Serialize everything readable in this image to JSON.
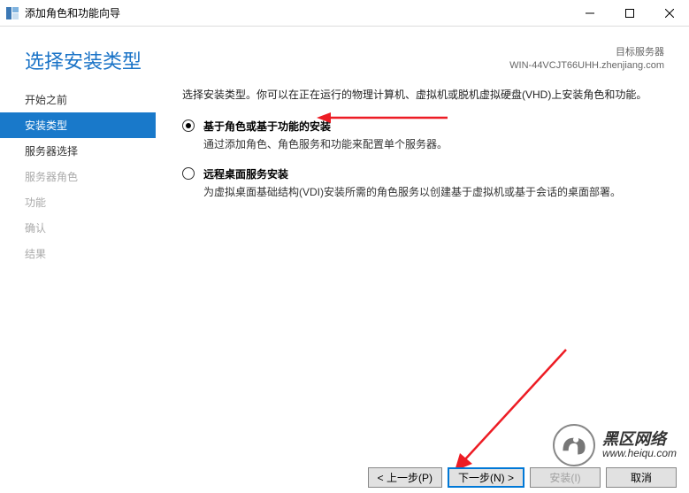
{
  "window": {
    "title": "添加角色和功能向导"
  },
  "header": {
    "page_title": "选择安装类型",
    "target_label": "目标服务器",
    "target_value": "WIN-44VCJT66UHH.zhenjiang.com"
  },
  "sidebar": {
    "items": [
      {
        "label": "开始之前"
      },
      {
        "label": "安装类型"
      },
      {
        "label": "服务器选择"
      },
      {
        "label": "服务器角色"
      },
      {
        "label": "功能"
      },
      {
        "label": "确认"
      },
      {
        "label": "结果"
      }
    ]
  },
  "main": {
    "instruction": "选择安装类型。你可以在正在运行的物理计算机、虚拟机或脱机虚拟硬盘(VHD)上安装角色和功能。",
    "options": [
      {
        "title": "基于角色或基于功能的安装",
        "desc": "通过添加角色、角色服务和功能来配置单个服务器。",
        "checked": true
      },
      {
        "title": "远程桌面服务安装",
        "desc": "为虚拟桌面基础结构(VDI)安装所需的角色服务以创建基于虚拟机或基于会话的桌面部署。",
        "checked": false
      }
    ]
  },
  "footer": {
    "prev": "< 上一步(P)",
    "next": "下一步(N) >",
    "install": "安装(I)",
    "cancel": "取消"
  },
  "watermark": {
    "cn": "黑区网络",
    "url": "www.heiqu.com"
  }
}
